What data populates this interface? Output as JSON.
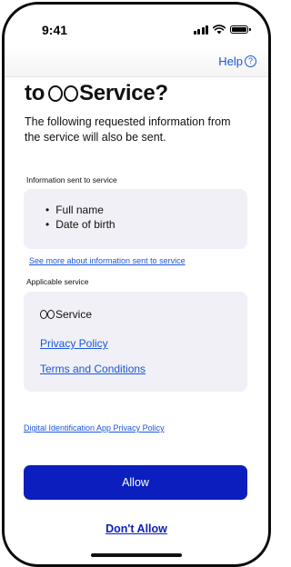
{
  "status_bar": {
    "time": "9:41"
  },
  "nav": {
    "help_label": "Help",
    "help_icon": "question-circle-icon"
  },
  "header": {
    "title_prefix": "to",
    "title_suffix": "Service?",
    "description": "The following requested information from the service will also be sent."
  },
  "info_section": {
    "label": "Information sent to service",
    "items": [
      "Full name",
      "Date of birth"
    ],
    "see_more_link": "See more about information sent to service"
  },
  "service_section": {
    "label": "Applicable service",
    "service_name": "Service",
    "privacy_policy_link": "Privacy Policy",
    "terms_link": "Terms and Conditions"
  },
  "app_privacy_link": "Digital Identification App Privacy Policy",
  "actions": {
    "allow_label": "Allow",
    "dont_allow_label": "Don't Allow"
  },
  "colors": {
    "primary": "#0a1fbd",
    "link": "#1a56db",
    "card_bg": "#f0f0f6"
  }
}
